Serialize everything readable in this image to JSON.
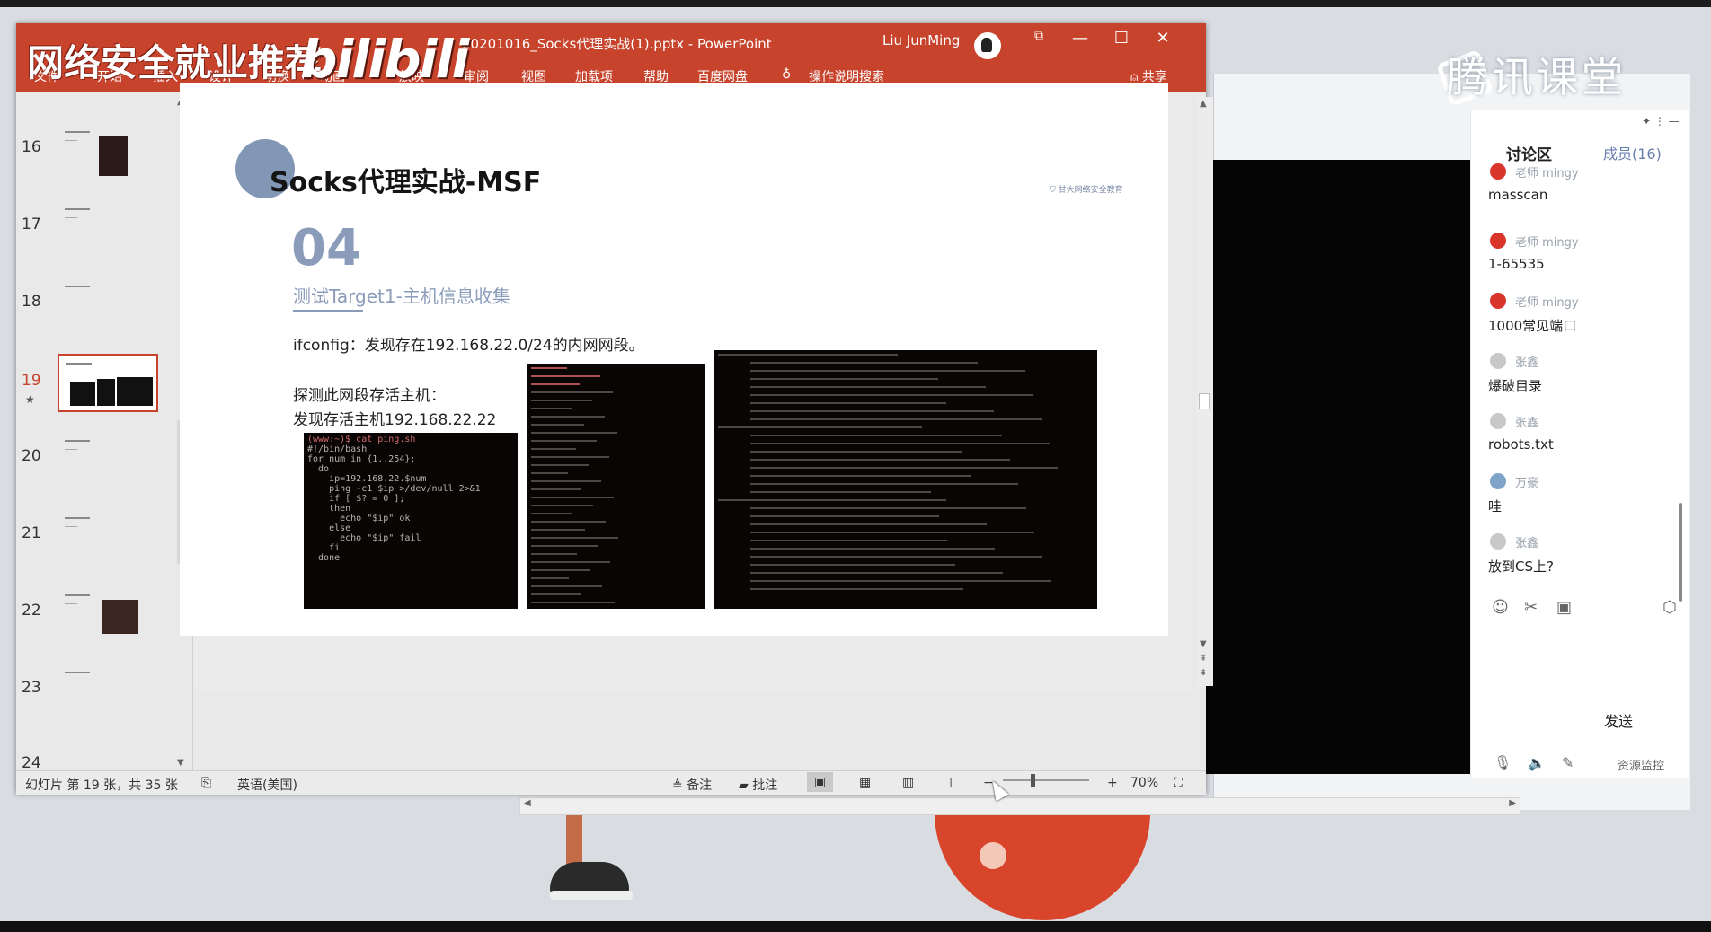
{
  "ppt": {
    "watermark": "网络安全就业推荐",
    "brand": "bilibili",
    "window_title": "20201016_Socks代理实战(1).pptx  -  PowerPoint",
    "user": "Liu JunMing",
    "ribbon_tabs": [
      "文件",
      "开始",
      "插入",
      "设计",
      "切换",
      "动画",
      "放映",
      "审阅",
      "视图",
      "加载项",
      "帮助",
      "百度网盘"
    ],
    "tell_me": "操作说明搜索",
    "share": "共享",
    "thumb_numbers": [
      "16",
      "17",
      "18",
      "19",
      "20",
      "21",
      "22",
      "23",
      "24"
    ],
    "selected_slide": "19",
    "slide": {
      "title": "Socks代理实战-MSF",
      "logo_text": "甘大网络安全教育",
      "number": "04",
      "subtitle": "测试Target1-主机信息收集",
      "line1": "ifconfig：发现存在192.168.22.0/24的内网网段。",
      "line2": "探测此网段存活主机：",
      "line3": "发现存活主机192.168.22.22"
    },
    "terminal_script": [
      "(www:~)$ cat ping.sh",
      "#!/bin/bash",
      "",
      "for num in {1..254};",
      "  do",
      "    ip=192.168.22.$num",
      "    ping -c1 $ip >/dev/null 2>&1",
      "    if [ $? = 0 ];",
      "    then",
      "      echo \"$ip\" ok",
      "    else",
      "      echo \"$ip\" fail",
      "    fi",
      "  done"
    ],
    "status": {
      "slide_counter": "幻灯片 第 19 张，共 35 张",
      "language": "英语(美国)",
      "notes": "备注",
      "comments": "批注",
      "zoom": "70%"
    }
  },
  "classroom": {
    "brand": "腾讯课堂",
    "tab_discussion": "讨论区",
    "tab_members": "成员(16)",
    "messages": [
      {
        "name": "老师 mingy",
        "text": "masscan",
        "color": "#d9352b"
      },
      {
        "name": "老师 mingy",
        "text": "1-65535",
        "color": "#d9352b"
      },
      {
        "name": "老师 mingy",
        "text": "1000常见端口",
        "color": "#d9352b"
      },
      {
        "name": "张鑫",
        "text": "爆破目录",
        "color": "#c8c8c8"
      },
      {
        "name": "张鑫",
        "text": "robots.txt",
        "color": "#c8c8c8"
      },
      {
        "name": "万豪",
        "text": "哇",
        "color": "#7fa4c7"
      },
      {
        "name": "张鑫",
        "text": "放到CS上?",
        "color": "#c8c8c8"
      }
    ],
    "send": "发送",
    "resource_monitor": "资源监控"
  }
}
